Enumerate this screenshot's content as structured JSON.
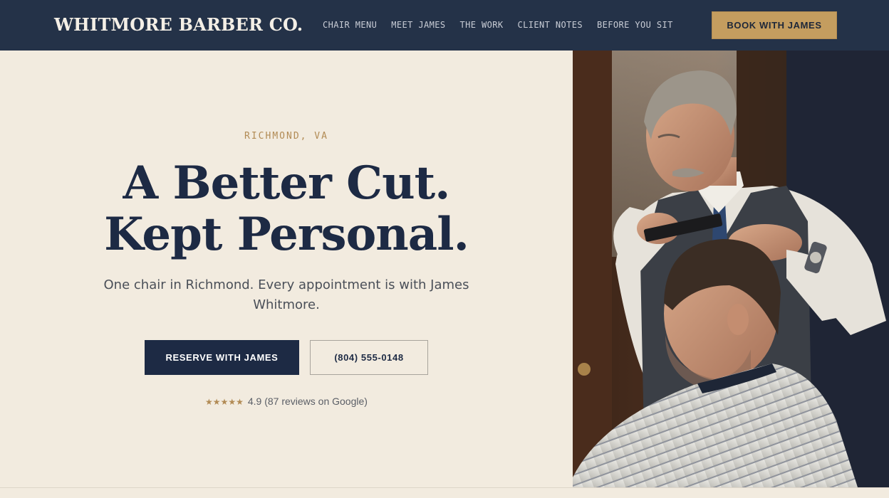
{
  "nav": {
    "brand": "WHITMORE BARBER CO.",
    "links": [
      "CHAIR MENU",
      "MEET JAMES",
      "THE WORK",
      "CLIENT NOTES",
      "BEFORE YOU SIT"
    ],
    "cta_label": "BOOK WITH JAMES"
  },
  "hero": {
    "eyebrow": "RICHMOND, VA",
    "headline_line1": "A Better Cut.",
    "headline_line2": "Kept Personal.",
    "subhead": "One chair in Richmond. Every appointment is with James Whitmore.",
    "primary_button": "RESERVE WITH JAMES",
    "secondary_button": "(804) 555-0148",
    "rating_stars": "★★★★★",
    "rating_text": "4.9 (87 reviews on Google)"
  },
  "photo": {
    "description_icon": "barber-photo"
  },
  "colors": {
    "nav_bg": "#243248",
    "accent_gold": "#c49d5f",
    "navy": "#1d2a44",
    "cream_bg": "#f2ebdf"
  }
}
